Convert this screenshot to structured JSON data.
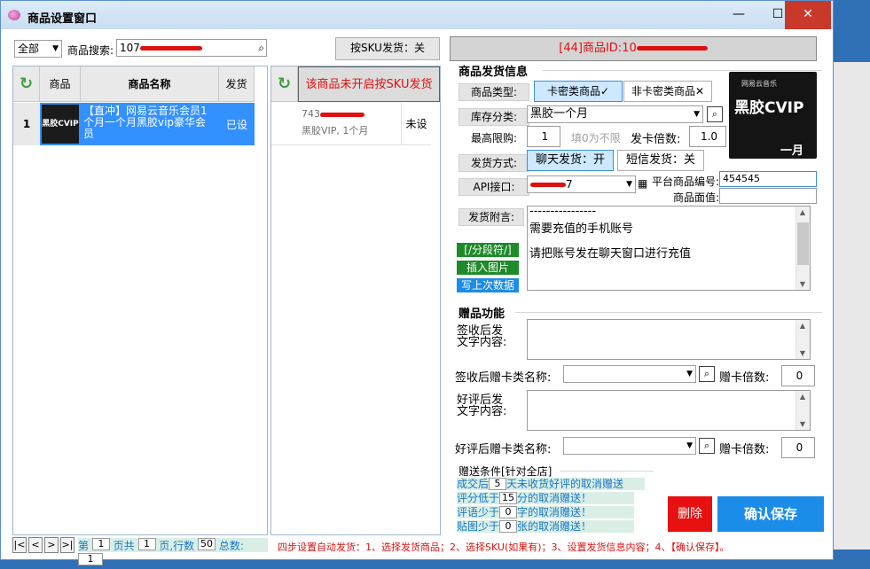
{
  "window": {
    "title": "商品设置窗口",
    "minimize": "—",
    "maximize": "☐",
    "close": "✕"
  },
  "toolbar": {
    "category": "全部",
    "search_label": "商品搜索:",
    "search_prefix": "107",
    "sku_toggle": "按SKU发货：关",
    "product_id_label": "[44]商品ID:",
    "product_id_prefix": "10"
  },
  "left_grid": {
    "headers": [
      "商品",
      "商品名称",
      "发货"
    ],
    "rows": [
      {
        "index": "1",
        "thumb_text": "黑胶CVIP",
        "name": "【直冲】网易云音乐会员1个月一个月黑胶vip豪华会员",
        "status": "已设"
      }
    ]
  },
  "mid_grid": {
    "header_text": "该商品未开启按SKU发货",
    "rows": [
      {
        "sku_prefix": "743",
        "sku_desc": "黑胶VIP, 1个月",
        "status": "未设"
      }
    ]
  },
  "shipping": {
    "group_title": "商品发货信息",
    "type_label": "商品类型:",
    "type_card": "卡密类商品✓",
    "type_noncard": "非卡密类商品✕",
    "stock_label": "库存分类:",
    "stock_value": "黑胶一个月",
    "limit_label": "最高限购:",
    "limit_value": "1",
    "limit_hint": "填0为不限",
    "multiple_label": "发卡倍数:",
    "multiple_value": "1.0",
    "method_label": "发货方式:",
    "method_chat": "聊天发货：开",
    "method_sms": "短信发货：关",
    "api_label": "API接口:",
    "api_prefix": "",
    "api_suffix": "7",
    "platform_code_label": "平台商品编号:",
    "platform_code_value": "454545",
    "face_value_label": "商品面值:",
    "face_value": "",
    "note_label": "发货附言:",
    "note_lines": [
      "----------------",
      "需要充值的手机账号",
      "请把账号发在聊天窗口进行充值"
    ],
    "btn_separator": "[/分段符/]",
    "btn_insert_image": "插入图片",
    "btn_last_data": "写上次数据",
    "thumb_logo": "网易云音乐",
    "thumb_main": "黑胶CVIP",
    "thumb_sub": "一月"
  },
  "gift": {
    "group_title": "赠品功能",
    "receipt_text_label": "签收后发\n文字内容:",
    "receipt_card_label": "签收后赠卡类名称:",
    "receipt_card_multiple_label": "赠卡倍数:",
    "receipt_card_multiple_value": "0",
    "review_text_label": "好评后发\n文字内容:",
    "review_card_label": "好评后赠卡类名称:",
    "review_card_multiple_label": "赠卡倍数:",
    "review_card_multiple_value": "0"
  },
  "conditions": {
    "title": "赠送条件[针对全店]",
    "row1_a": "成交后",
    "row1_v": "5",
    "row1_b": "天未收货好评的取消赠送",
    "row2_a": "评分低于",
    "row2_v": "15",
    "row2_b": "分的取消赠送！",
    "row3_a": "评语少于",
    "row3_v": "0",
    "row3_b": "字的取消赠送！",
    "row4_a": "贴图少于",
    "row4_v": "0",
    "row4_b": "张的取消赠送！"
  },
  "actions": {
    "delete": "删除",
    "save": "确认保存"
  },
  "pager": {
    "first": "|<",
    "prev": "<",
    "next": ">",
    "last": ">|",
    "page_label": "第",
    "page_value": "1",
    "total_label": "页共",
    "total_value": "1",
    "rows_label": "页,行数",
    "rows_value": "50",
    "count_label": "总数:",
    "count_value": "1"
  },
  "hint": "四步设置自动发货：1、选择发货商品；2、选择SKU(如果有)；3、设置发货信息内容；4、【确认保存】。",
  "colors": {
    "accent": "#3390ff",
    "danger": "#e01010",
    "save": "#1b8ce8"
  }
}
